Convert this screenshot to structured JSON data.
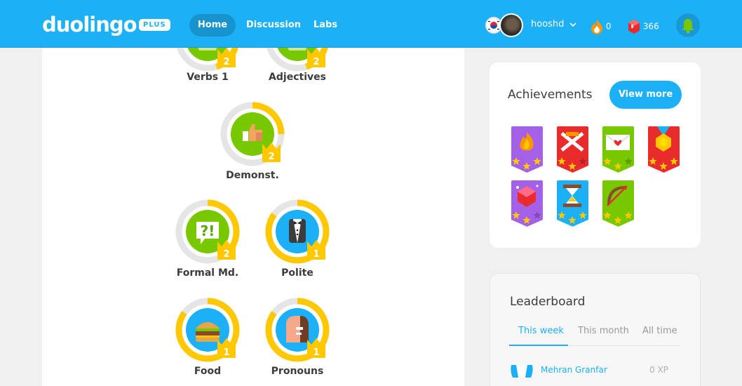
{
  "topbar": {
    "logo": "duolingo",
    "plus_badge": "PLUS",
    "nav": [
      "Home",
      "Discussion",
      "Labs"
    ],
    "username": "hooshd",
    "streak": "0",
    "gems": "366"
  },
  "skills": [
    {
      "label": "Verbs 1",
      "level": "2",
      "icon": "verbs-icon",
      "progress": 0.45
    },
    {
      "label": "Adjectives",
      "level": "2",
      "icon": "adjectives-icon",
      "progress": 0.45
    },
    {
      "label": "Demonst.",
      "level": "2",
      "icon": "thumbs-up-icon",
      "progress": 0.25
    },
    {
      "label": "Formal Md.",
      "level": "2",
      "icon": "speech-bubble-icon",
      "progress": 0.35
    },
    {
      "label": "Polite",
      "level": "1",
      "icon": "tuxedo-icon",
      "progress": 0.85
    },
    {
      "label": "Food",
      "level": "1",
      "icon": "burger-icon",
      "progress": 0.85
    },
    {
      "label": "Pronouns",
      "level": "1",
      "icon": "person-icon",
      "progress": 0.85
    }
  ],
  "achievements": {
    "title": "Achievements",
    "view_more": "View more",
    "badges": [
      {
        "icon": "fire-icon",
        "color": "#a560e8",
        "stars": 3
      },
      {
        "icon": "swords-icon",
        "color": "#ea2b2b",
        "stars": 2
      },
      {
        "icon": "envelope-heart-icon",
        "color": "#78c800",
        "stars": 2
      },
      {
        "icon": "medal-icon",
        "color": "#ea2b2b",
        "stars": 3
      },
      {
        "icon": "gem-icon",
        "color": "#a560e8",
        "stars": 2
      },
      {
        "icon": "hourglass-icon",
        "color": "#1cb0f6",
        "stars": 3
      },
      {
        "icon": "bow-arrow-icon",
        "color": "#78c800",
        "stars": 3
      }
    ]
  },
  "leaderboard": {
    "title": "Leaderboard",
    "tabs": [
      "This week",
      "This month",
      "All time"
    ],
    "entries": [
      {
        "name": "Mehran Granfar",
        "xp": "0 XP"
      }
    ]
  }
}
